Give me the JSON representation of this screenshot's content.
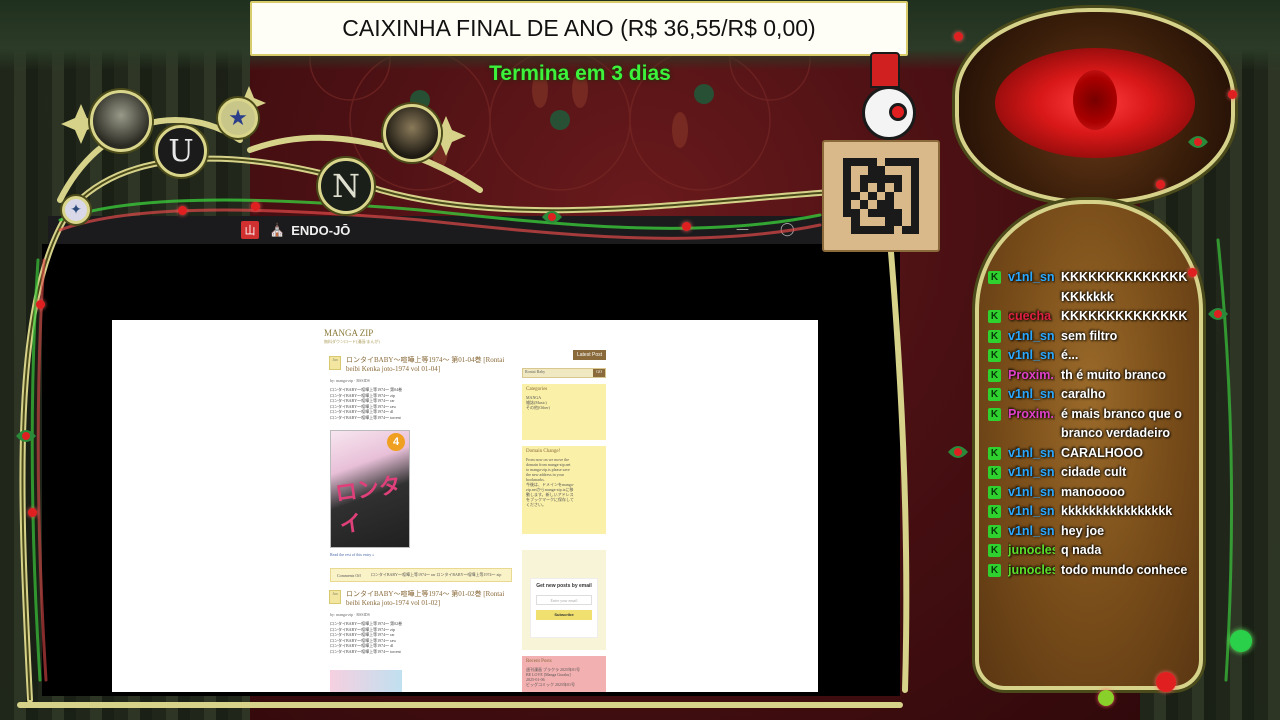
{
  "goal": {
    "title": "CAIXINHA FINAL DE ANO (R$ 36,55/R$ 0,00)",
    "subtitle": "Termina em 3 dias"
  },
  "badges": {
    "u_letter": "U",
    "n_letter": "N",
    "star": "★",
    "small": "✦"
  },
  "game_window": {
    "app_icon": "山",
    "glyph": "⛪",
    "title": "ENDO-JŌ",
    "minimize": "—",
    "restore": "◯"
  },
  "browser": {
    "site_title": "MANGA ZIP",
    "site_subtitle": "無料ダウンロード(漫画/まんが)",
    "post1": {
      "date_icon": "Jan",
      "title": "ロンタイBABY～喧嘩上等1974～ 第01-04巻 [Rontai beibi Kenka joto-1974 vol 01-04]",
      "meta": "by: manga-zip  ·  RSSIDS",
      "lines": [
        "ロンタイBABY～喧嘩上等1974～ 第04巻",
        "ロンタイBABY～喧嘩上等1974～ zip",
        "ロンタイBABY～喧嘩上等1974～ rar",
        "ロンタイBABY～喧嘩上等1974～ raw",
        "ロンタイBABY～喧嘩上等1974～ dl",
        "ロンタイBABY～喧嘩上等1974～ torrent"
      ],
      "cover_logo": "ロンタイ",
      "cover_num": "4",
      "read_more": "Read the rest of this entry »"
    },
    "comments_bar": {
      "label": "Comments Off",
      "tags": "ロンタイBABY～喧嘩上等1974～ rar  ロンタイBABY～喧嘩上等1974～ zip"
    },
    "post2": {
      "date_icon": "Jan",
      "title": "ロンタイBABY～喧嘩上等1974～ 第01-02巻 [Rontai beibi Kenka joto-1974 vol 01-02]",
      "meta": "by: manga-zip  ·  RSSIDS",
      "lines": [
        "ロンタイBABY～喧嘩上等1974～ 第02巻",
        "ロンタイBABY～喧嘩上等1974～ zip",
        "ロンタイBABY～喧嘩上等1974～ rar",
        "ロンタイBABY～喧嘩上等1974～ raw",
        "ロンタイBABY～喧嘩上等1974～ dl",
        "ロンタイBABY～喧嘩上等1974～ torrent"
      ]
    },
    "sidebar": {
      "latest_btn": "Latest Post",
      "search_value": "Rontai Baby",
      "search_go": "GO",
      "categories_head": "Categories",
      "categories": [
        "MANGA",
        "雑誌(Music)",
        "その他(Other)"
      ],
      "domain_head": "Domain Change!",
      "domain_lines": [
        "From now on we move the",
        "domain from manga-zip.net",
        "to manga-zip.is please save",
        "the new address in your",
        "bookmarks.",
        "今後は、ドメインをmanga-",
        "zip.netからmanga-zip.isに移",
        "動します。新しいアドレス",
        "をブックマークに保存して",
        "ください。"
      ],
      "subscribe_title": "Get new posts by email",
      "subscribe_placeholder": "Enter your email",
      "subscribe_btn": "Subscribe",
      "recent_head": "Recent Posts",
      "recent_lines": [
        "週刊漫画 ブラクラ 2025年01号",
        "BE LOVE [Manga Goraku]",
        "2025-01-06",
        "ビッグコミック 2025年01号"
      ]
    }
  },
  "chat": {
    "messages": [
      {
        "user": "v1nl_sn",
        "text": "KKKKKKKKKKKKKKKKkkkkk",
        "color": "#2aa8ff"
      },
      {
        "user": "cuecha",
        "text": "KKKKKKKKKKKKKK",
        "color": "#e02040"
      },
      {
        "user": "v1nl_sn",
        "text": "sem filtro",
        "color": "#2aa8ff"
      },
      {
        "user": "v1nl_sn",
        "text": "é...",
        "color": "#2aa8ff"
      },
      {
        "user": "Proxim...",
        "text": "th é muito branco",
        "color": "#e040c8"
      },
      {
        "user": "v1nl_sn",
        "text": "caralho",
        "color": "#2aa8ff"
      },
      {
        "user": "Proxim...",
        "text": "é mais branco que o branco verdadeiro",
        "color": "#e040c8"
      },
      {
        "user": "v1nl_sn",
        "text": "CARALHOOO",
        "color": "#2aa8ff"
      },
      {
        "user": "v1nl_sn",
        "text": "cidade cult",
        "color": "#2aa8ff"
      },
      {
        "user": "v1nl_sn",
        "text": "manooooo",
        "color": "#2aa8ff"
      },
      {
        "user": "v1nl_sn",
        "text": "kkkkkkkkkkkkkkkk",
        "color": "#2aa8ff"
      },
      {
        "user": "v1nl_sn",
        "text": "hey joe",
        "color": "#2aa8ff"
      },
      {
        "user": "junocles",
        "text": "q nada",
        "color": "#5ae02a"
      },
      {
        "user": "junocles",
        "text": "todo mundo conhece",
        "color": "#5ae02a"
      }
    ],
    "badge_letter": "K"
  },
  "colors": {
    "frame_gold": "#d6d28a",
    "goal_green": "#3df23a",
    "wall_red": "#4a1013",
    "curtain_green": "#2d3a28"
  }
}
